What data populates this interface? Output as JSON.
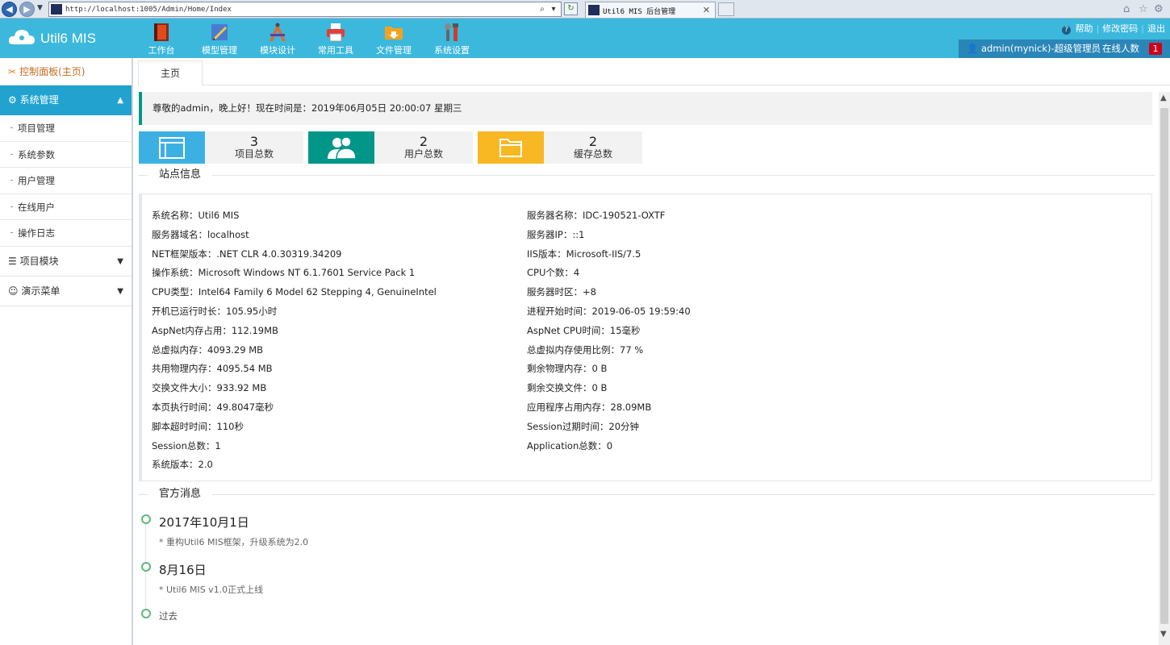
{
  "browser": {
    "address": "http://localhost:1005/Admin/Home/Index",
    "tab_title": "Util6 MIS 后台管理",
    "icons": [
      "back-icon",
      "forward-icon",
      "search-icon",
      "refresh-icon",
      "home-icon",
      "star-icon",
      "gear-icon"
    ]
  },
  "header": {
    "app_name": "Util6 MIS",
    "nav": [
      {
        "label": "工作台",
        "icon": "workbench-icon"
      },
      {
        "label": "模型管理",
        "icon": "model-icon"
      },
      {
        "label": "模块设计",
        "icon": "design-icon"
      },
      {
        "label": "常用工具",
        "icon": "printer-icon"
      },
      {
        "label": "文件管理",
        "icon": "folder-icon"
      },
      {
        "label": "系统设置",
        "icon": "tools-icon"
      }
    ],
    "links": {
      "help": "帮助",
      "change_password": "修改密码",
      "logout": "退出"
    },
    "user": "admin(mynick)-超级管理员",
    "online_label": "在线人数",
    "online_count": "1"
  },
  "sidebar": {
    "home": "控制面板(主页)",
    "groups": [
      {
        "label": "系统管理",
        "expanded": true,
        "items": [
          "项目管理",
          "系统参数",
          "用户管理",
          "在线用户",
          "操作日志"
        ]
      },
      {
        "label": "项目模块",
        "expanded": false
      },
      {
        "label": "演示菜单",
        "expanded": false
      }
    ]
  },
  "main": {
    "tab": "主页",
    "welcome": "尊敬的admin，晚上好！现在时间是：2019年06月05日 20:00:07 星期三",
    "stats": [
      {
        "value": "3",
        "label": "项目总数",
        "color": "#3cb0e2",
        "icon": "window-icon"
      },
      {
        "value": "2",
        "label": "用户总数",
        "color": "#009688",
        "icon": "users-icon"
      },
      {
        "value": "2",
        "label": "缓存总数",
        "color": "#f7b824",
        "icon": "folder-icon"
      }
    ],
    "site_info_title": "站点信息",
    "site_info_left": [
      "系统名称：Util6 MIS",
      "服务器域名：localhost",
      "NET框架版本：.NET CLR 4.0.30319.34209",
      "操作系统：Microsoft Windows NT 6.1.7601 Service Pack 1",
      "CPU类型：Intel64 Family 6 Model 62 Stepping 4, GenuineIntel",
      "开机已运行时长：105.95小时",
      "AspNet内存占用：112.19MB",
      "总虚拟内存：4093.29 MB",
      "共用物理内存：4095.54 MB",
      "交换文件大小：933.92 MB",
      "本页执行时间：49.8047毫秒",
      "脚本超时时间：110秒",
      "Session总数：1",
      "系统版本：2.0"
    ],
    "site_info_right": [
      "服务器名称：IDC-190521-OXTF",
      "服务器IP：::1",
      "IIS版本：Microsoft-IIS/7.5",
      "CPU个数：4",
      "服务器时区：+8",
      "进程开始时间：2019-06-05 19:59:40",
      "AspNet CPU时间：15毫秒",
      "总虚拟内存使用比例：77 %",
      "剩余物理内存：0 B",
      "剩余交换文件：0 B",
      "应用程序占用内存：28.09MB",
      "Session过期时间：20分钟",
      "Application总数：0"
    ],
    "news_title": "官方消息",
    "timeline": [
      {
        "title": "2017年10月1日",
        "body": "* 重构Util6 MIS框架，升级系统为2.0"
      },
      {
        "title": "8月16日",
        "body": "* Util6 MIS v1.0正式上线"
      },
      {
        "title": "过去",
        "body": ""
      }
    ]
  }
}
